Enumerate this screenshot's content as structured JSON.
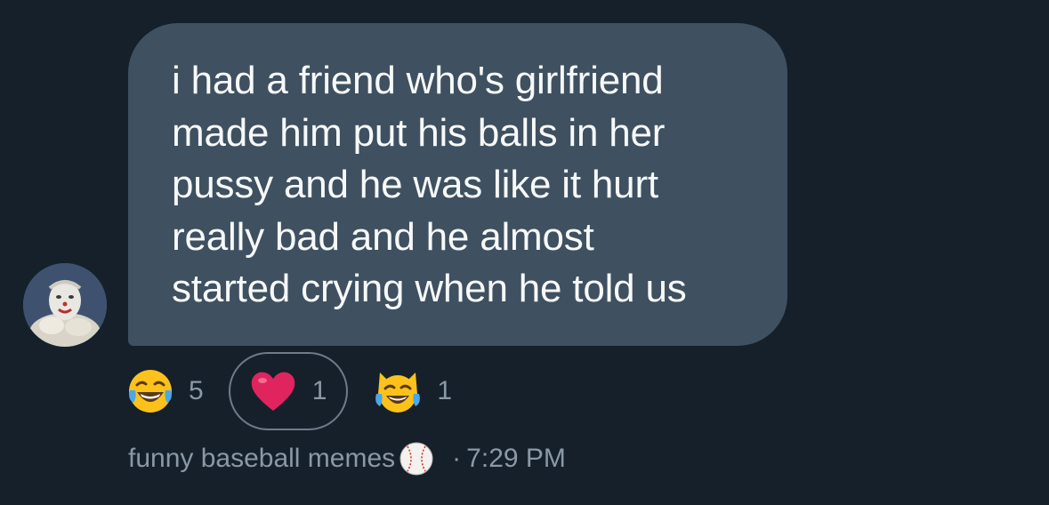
{
  "message": {
    "text": "i had a friend who's girlfriend\nmade him put his balls in her\npussy and he was like it hurt\nreally bad and he almost\nstarted crying when he told us"
  },
  "reactions": [
    {
      "icon": "face-with-tears-of-joy-icon",
      "count": "5"
    },
    {
      "icon": "red-heart-icon",
      "count": "1",
      "selected": true
    },
    {
      "icon": "cat-with-tears-of-joy-icon",
      "count": "1"
    }
  ],
  "meta": {
    "sender": "funny baseball memes",
    "sender_icon": "baseball-icon",
    "separator": "·",
    "time": "7:29 PM"
  },
  "colors": {
    "background": "#15202b",
    "bubble": "#3f5060",
    "text": "#f7f9f9",
    "muted": "#8b98a5",
    "heart": "#e0245e"
  }
}
